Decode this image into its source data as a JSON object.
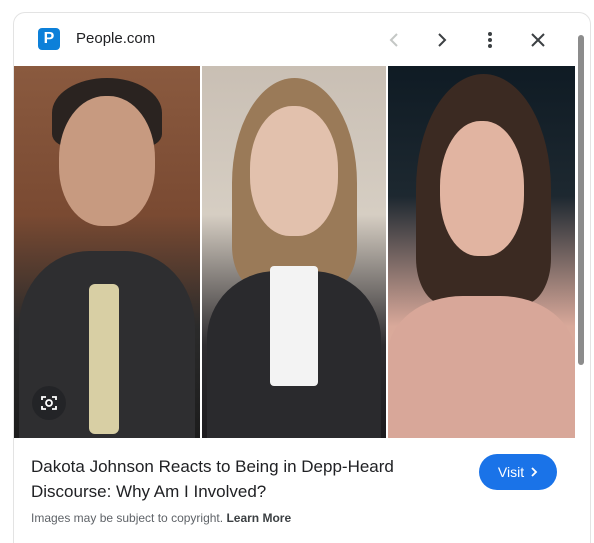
{
  "header": {
    "site_logo_letter": "P",
    "site_name": "People.com",
    "icons": [
      "chevron-left-icon",
      "chevron-right-icon",
      "more-vert-icon",
      "close-icon"
    ]
  },
  "images": [
    {
      "name": "johnny-depp-photo"
    },
    {
      "name": "amber-heard-photo"
    },
    {
      "name": "dakota-johnson-photo"
    }
  ],
  "headline": "Dakota Johnson Reacts to Being in Depp-Heard Discourse: Why Am I Involved?",
  "visit_button": {
    "label": "Visit",
    "icon": "chevron-right-icon"
  },
  "footer": {
    "copyright_text": "Images may be subject to copyright.",
    "learn_more": "Learn More"
  },
  "colors": {
    "accent": "#1a73e8",
    "logo": "#0d80d9",
    "text": "#202124",
    "muted": "#5f6368"
  }
}
